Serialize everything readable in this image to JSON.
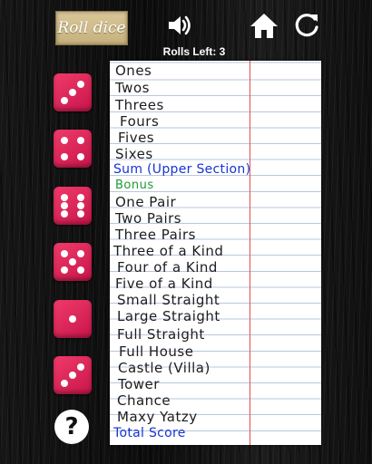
{
  "header": {
    "roll_button_label": "Roll dice",
    "rolls_left_text": "Rolls Left: 3",
    "sound_icon": "speaker-icon",
    "home_icon": "home-icon",
    "restart_icon": "restart-icon"
  },
  "dice": [
    {
      "value": 3
    },
    {
      "value": 4
    },
    {
      "value": 6
    },
    {
      "value": 5
    },
    {
      "value": 1
    },
    {
      "value": 3
    }
  ],
  "help_label": "?",
  "scorecard": {
    "rows": [
      {
        "label": "Ones",
        "style": "category"
      },
      {
        "label": "Twos",
        "style": "category"
      },
      {
        "label": "Threes",
        "style": "category"
      },
      {
        "label": "Fours",
        "style": "category"
      },
      {
        "label": "Fives",
        "style": "category"
      },
      {
        "label": "Sixes",
        "style": "category"
      },
      {
        "label": "Sum (Upper Section)",
        "style": "sum"
      },
      {
        "label": "Bonus",
        "style": "bonus"
      },
      {
        "label": "One Pair",
        "style": "category"
      },
      {
        "label": "Two Pairs",
        "style": "category"
      },
      {
        "label": "Three Pairs",
        "style": "category"
      },
      {
        "label": "Three of a Kind",
        "style": "category"
      },
      {
        "label": "Four of a Kind",
        "style": "category"
      },
      {
        "label": "Five of a Kind",
        "style": "category"
      },
      {
        "label": "Small Straight",
        "style": "category"
      },
      {
        "label": "Large Straight",
        "style": "category"
      },
      {
        "label": "Full Straight",
        "style": "category"
      },
      {
        "label": "Full House",
        "style": "category"
      },
      {
        "label": "Castle (Villa)",
        "style": "category"
      },
      {
        "label": "Tower",
        "style": "category"
      },
      {
        "label": "Chance",
        "style": "category"
      },
      {
        "label": "Maxy Yatzy",
        "style": "category"
      },
      {
        "label": "Total Score",
        "style": "sum"
      }
    ]
  },
  "colors": {
    "die_face": "#e0285c",
    "sum_text": "#1633d6",
    "bonus_text": "#1e9b35",
    "margin_line": "#e05050"
  }
}
